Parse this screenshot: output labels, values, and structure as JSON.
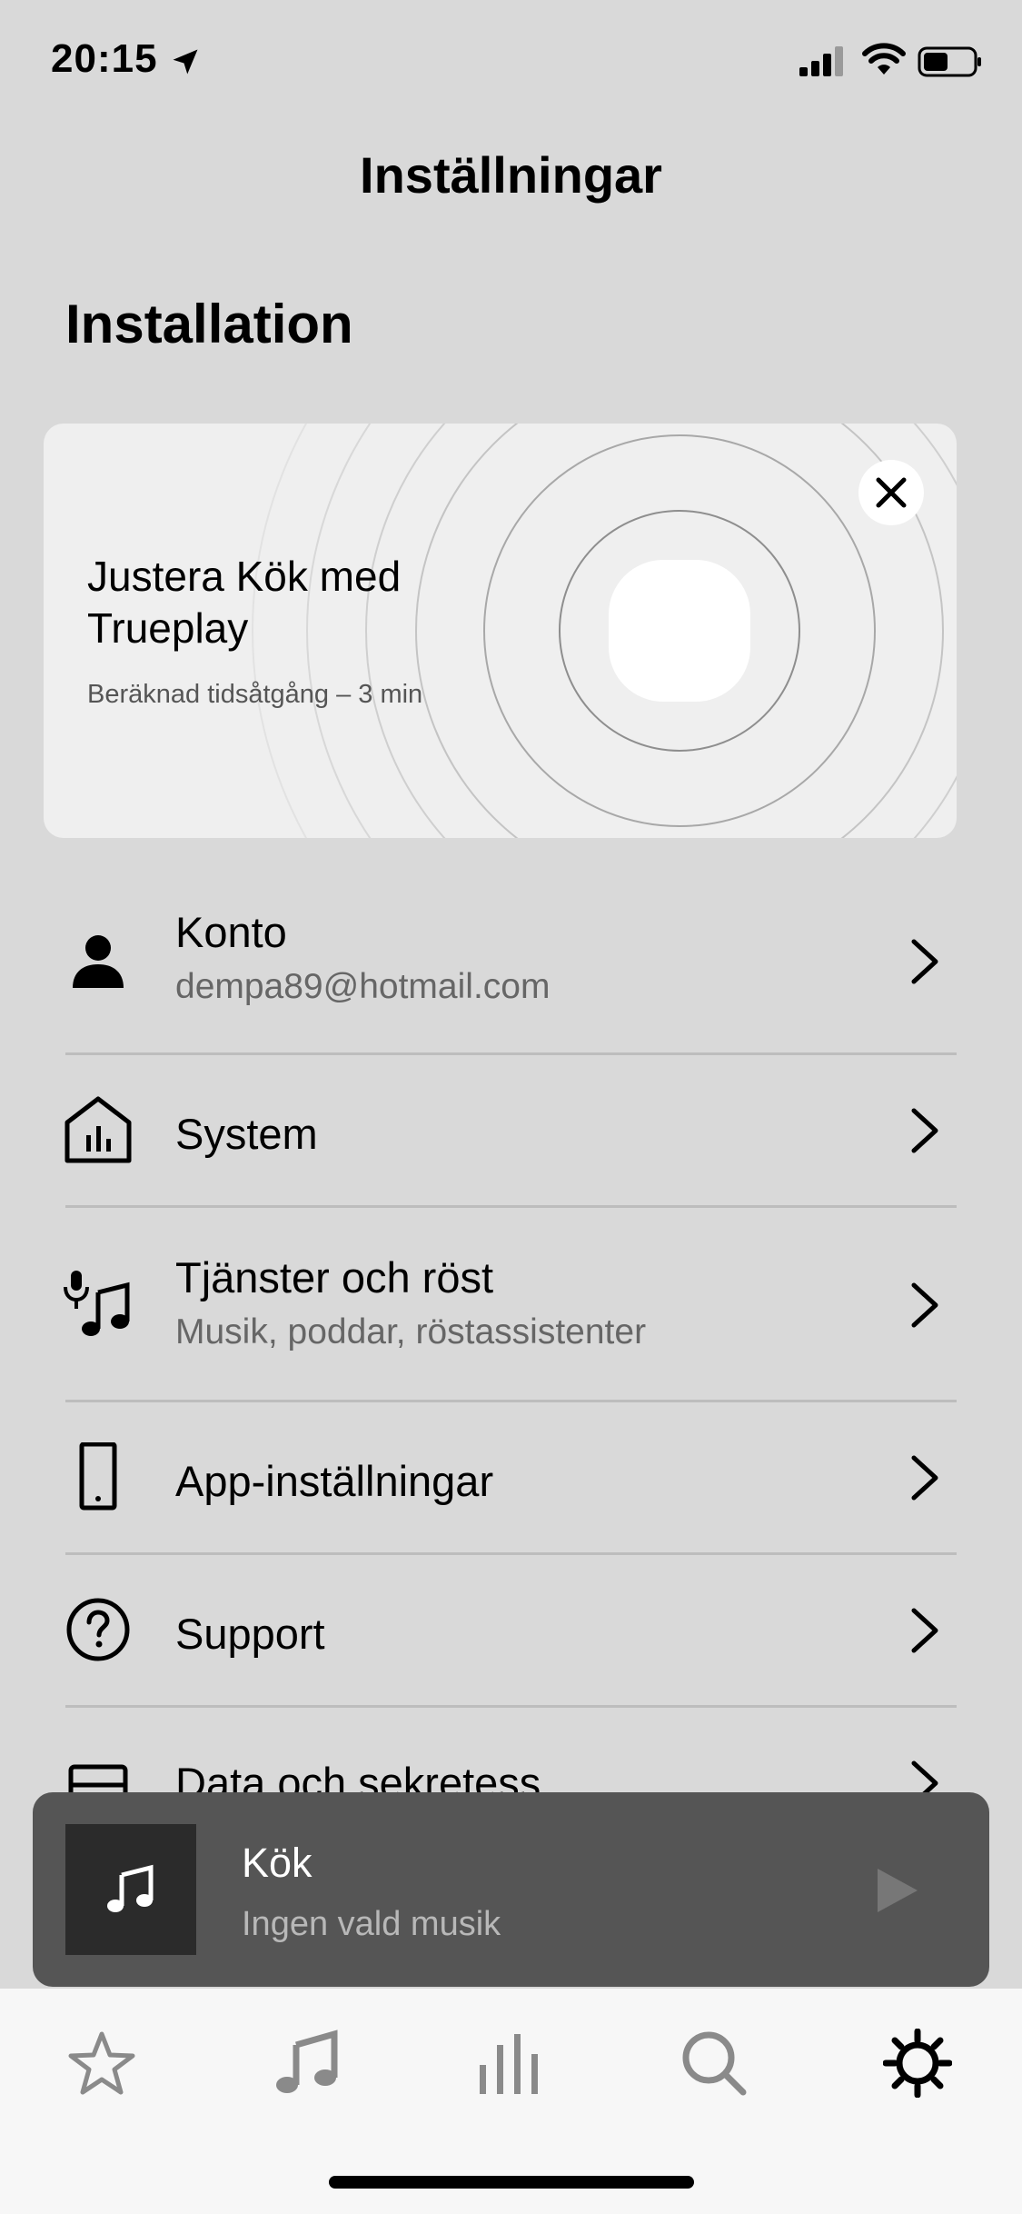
{
  "status_bar": {
    "time": "20:15",
    "icons": [
      "location-arrow-icon",
      "cellular-signal-icon",
      "wifi-icon",
      "battery-icon"
    ]
  },
  "page": {
    "title": "Inställningar",
    "section_title": "Installation"
  },
  "trueplay_card": {
    "title": "Justera Kök med Trueplay",
    "subtitle": "Beräknad tidsåtgång – 3 min",
    "icons": [
      "speaker-rings-graphic",
      "close-icon"
    ]
  },
  "menu": {
    "items": [
      {
        "label": "Konto",
        "subtitle": "dempa89@hotmail.com",
        "icon": "person-icon"
      },
      {
        "label": "System",
        "subtitle": "",
        "icon": "house-bars-icon"
      },
      {
        "label": "Tjänster och röst",
        "subtitle": "Musik, poddar, röstassistenter",
        "icon": "mic-music-icon"
      },
      {
        "label": "App-inställningar",
        "subtitle": "",
        "icon": "phone-icon"
      },
      {
        "label": "Support",
        "subtitle": "",
        "icon": "question-circle-icon"
      },
      {
        "label": "Data och sekretess",
        "subtitle": "",
        "icon": "data-drawer-icon"
      }
    ]
  },
  "now_playing": {
    "room": "Kök",
    "status": "Ingen vald musik",
    "icons": [
      "music-note-icon",
      "play-icon"
    ]
  },
  "tab_bar": {
    "tabs": [
      {
        "name": "favorites",
        "icon": "star-icon",
        "active": false
      },
      {
        "name": "music",
        "icon": "music-note-icon",
        "active": false
      },
      {
        "name": "system",
        "icon": "equalizer-bars-icon",
        "active": false
      },
      {
        "name": "search",
        "icon": "search-icon",
        "active": false
      },
      {
        "name": "settings",
        "icon": "gear-icon",
        "active": true
      }
    ]
  },
  "colors": {
    "background": "#d9d9d9",
    "card": "#efefef",
    "now_playing_bar": "#555555",
    "tab_bar": "#f7f7f7",
    "inactive_icon": "#8a8a8a"
  }
}
